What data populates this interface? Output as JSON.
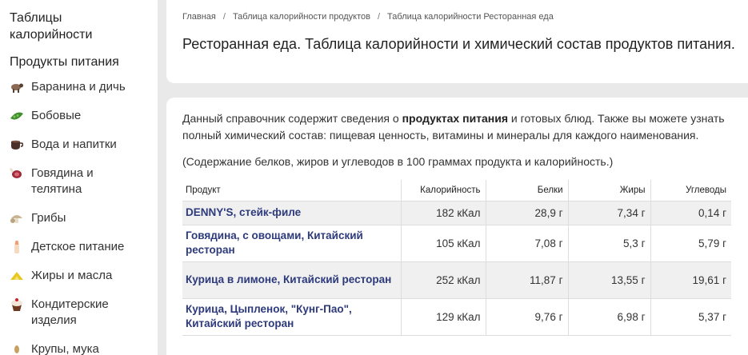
{
  "sidebar": {
    "title": "Таблицы калорийности",
    "section": "Продукты питания",
    "items": [
      {
        "label": "Баранина и дичь",
        "icon": "sheep-icon"
      },
      {
        "label": "Бобовые",
        "icon": "bean-pod-icon"
      },
      {
        "label": "Вода и напитки",
        "icon": "coffee-cup-icon"
      },
      {
        "label": "Говядина и телятина",
        "icon": "ham-icon"
      },
      {
        "label": "Грибы",
        "icon": "mushroom-icon"
      },
      {
        "label": "Детское питание",
        "icon": "baby-bottle-icon"
      },
      {
        "label": "Жиры и масла",
        "icon": "butter-icon"
      },
      {
        "label": "Кондитерские изделия",
        "icon": "cupcake-icon"
      },
      {
        "label": "Крупы, мука",
        "icon": "grain-icon"
      }
    ]
  },
  "breadcrumb": [
    "Главная",
    "Таблица калорийности продуктов",
    "Таблица калорийности Ресторанная еда"
  ],
  "page_title": "Ресторанная еда. Таблица калорийности и химический состав продуктов питания.",
  "intro": {
    "before": "Данный справочник содержит сведения о ",
    "bold": "продуктах питания",
    "after": " и готовых блюд. Также вы можете узнать полный химический состав: пищевая ценность, витамины и минералы для каждого наименования."
  },
  "note": "(Содержание белков, жиров и углеводов в 100 граммах продукта и калорийность.)",
  "table": {
    "headers": [
      "Продукт",
      "Калорийность",
      "Белки",
      "Жиры",
      "Углеводы"
    ],
    "rows": [
      {
        "product": "DENNY'S, стейк-филе",
        "kcal": "182 кКал",
        "protein": "28,9 г",
        "fat": "7,34 г",
        "carbs": "0,14 г"
      },
      {
        "product": "Говядина, с овощами, Китайский ресторан",
        "kcal": "105 кКал",
        "protein": "7,08 г",
        "fat": "5,3 г",
        "carbs": "5,79 г"
      },
      {
        "product": "Курица в лимоне, Китайский ресторан",
        "kcal": "252 кКал",
        "protein": "11,87 г",
        "fat": "13,55 г",
        "carbs": "19,61 г"
      },
      {
        "product": "Курица, Цыпленок, \"Кунг-Пао\", Китайский ресторан",
        "kcal": "129 кКал",
        "protein": "9,76 г",
        "fat": "6,98 г",
        "carbs": "5,37 г"
      }
    ]
  }
}
